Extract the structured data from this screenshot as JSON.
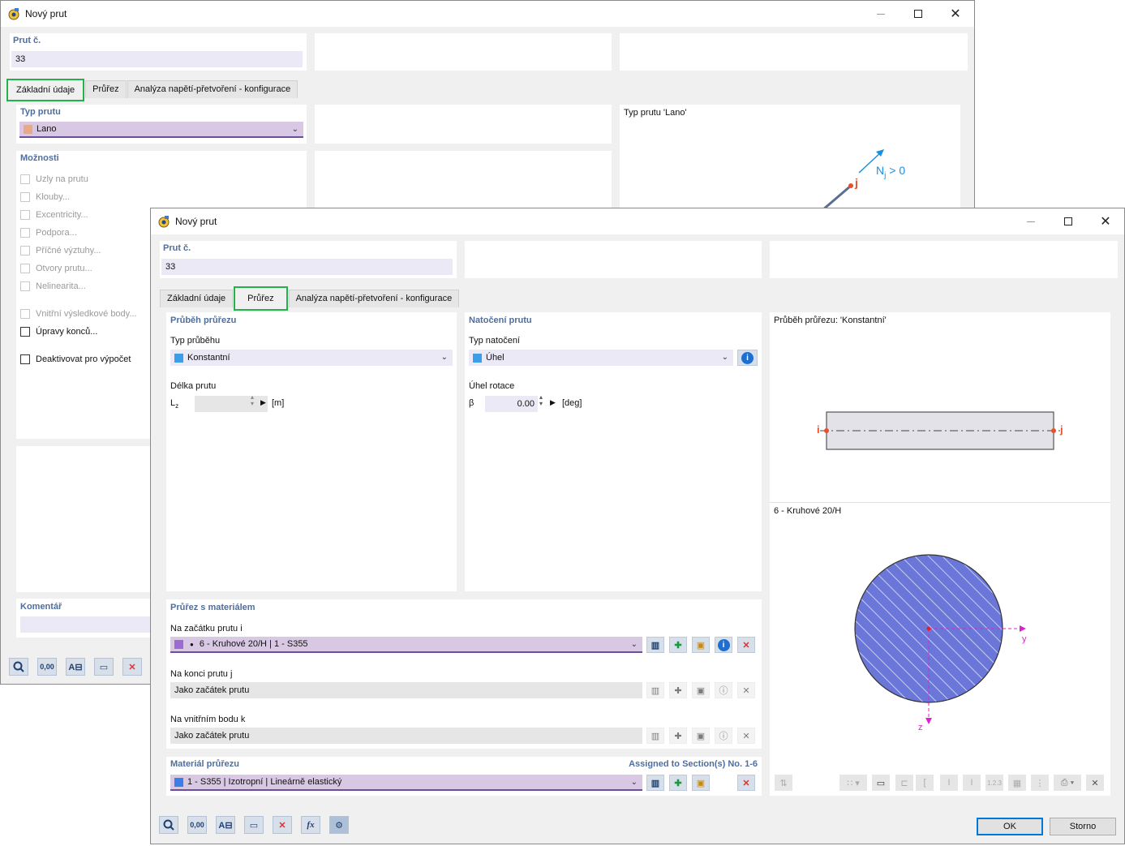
{
  "back_window": {
    "title": "Nový prut",
    "member_no_label": "Prut č.",
    "member_no_value": "33",
    "tabs": [
      "Základní údaje",
      "Průřez",
      "Analýza napětí-přetvoření - konfigurace"
    ],
    "member_type_label": "Typ prutu",
    "member_type_value": "Lano",
    "member_type_color": "#e7a98a",
    "options_label": "Možnosti",
    "options": [
      {
        "label": "Uzly na prutu",
        "checked": false,
        "enabled": false
      },
      {
        "label": "Klouby...",
        "checked": false,
        "enabled": false
      },
      {
        "label": "Excentricity...",
        "checked": false,
        "enabled": false
      },
      {
        "label": "Podpora...",
        "checked": false,
        "enabled": false
      },
      {
        "label": "Příčné výztuhy...",
        "checked": false,
        "enabled": false
      },
      {
        "label": "Otvory prutu...",
        "checked": false,
        "enabled": false
      },
      {
        "label": "Nelinearita...",
        "checked": false,
        "enabled": false
      },
      {
        "label": "Vnitřní výsledkové body...",
        "checked": false,
        "enabled": false
      },
      {
        "label": "Úpravy konců...",
        "checked": false,
        "enabled": true
      },
      {
        "label": "Deaktivovat pro výpočet",
        "checked": false,
        "enabled": true
      }
    ],
    "preview_title": "Typ prutu 'Lano'",
    "preview_node_label": "j",
    "preview_force_label": "N",
    "preview_force_sub": "j",
    "preview_force_tail": " > 0",
    "comment_label": "Komentář"
  },
  "front_window": {
    "title": "Nový prut",
    "member_no_label": "Prut č.",
    "member_no_value": "33",
    "tabs": [
      "Základní údaje",
      "Průřez",
      "Analýza napětí-přetvoření - konfigurace"
    ],
    "active_tab": 1,
    "section_dist": {
      "header": "Průběh průřezu",
      "type_label": "Typ průběhu",
      "type_value": "Konstantní",
      "type_color": "#3a9ee8",
      "length_label": "Délka prutu",
      "length_symbol": "L",
      "length_sub": "z",
      "length_unit": "[m]"
    },
    "rotation": {
      "header": "Natočení prutu",
      "type_label": "Typ natočení",
      "type_value": "Úhel",
      "type_color": "#3a9ee8",
      "angle_label": "Úhel rotace",
      "angle_symbol": "β",
      "angle_value": "0.00",
      "angle_unit": "[deg]"
    },
    "section_preview": {
      "title": "Průběh průřezu: 'Konstantní'",
      "node_i": "i",
      "node_j": "j",
      "section_name": "6 - Kruhové 20/H",
      "axis_y": "y",
      "axis_z": "z"
    },
    "section_material": {
      "header": "Průřez s materiálem",
      "start_label": "Na začátku prutu i",
      "start_value": "6 - Kruhové 20/H | 1 - S355",
      "start_color": "#9b6bd3",
      "end_label": "Na konci prutu j",
      "end_value": "Jako začátek prutu",
      "internal_label": "Na vnitřním bodu k",
      "internal_value": "Jako začátek prutu"
    },
    "material": {
      "header": "Materiál průřezu",
      "assigned": "Assigned to Section(s) No. 1-6",
      "value": "1 - S355 | Izotropní | Lineárně elastický",
      "color": "#3a7ee8"
    },
    "buttons": {
      "ok": "OK",
      "cancel": "Storno"
    },
    "toolbar_icons": [
      "search-icon",
      "number-format-icon",
      "info-view-icon",
      "display-icon",
      "delete-icon",
      "formula-icon",
      "settings-icon"
    ]
  }
}
